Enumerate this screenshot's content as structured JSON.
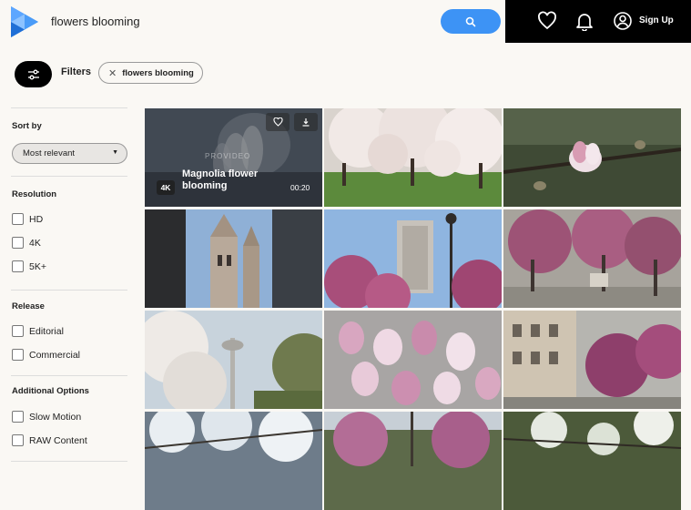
{
  "header": {
    "search_query": "flowers blooming",
    "signup_label": "Sign Up",
    "icons": [
      "logo-icon",
      "search-icon",
      "heart-icon",
      "bell-icon",
      "user-icon"
    ],
    "colors": {
      "search_button": "#3d93f5",
      "account_bar": "#000000",
      "logo": "#2f86f0"
    }
  },
  "filters": {
    "label": "Filters",
    "active_chip": "flowers blooming"
  },
  "sidebar": {
    "sort_title": "Sort by",
    "sort_value": "Most relevant",
    "resolution_title": "Resolution",
    "resolution_options": [
      "HD",
      "4K",
      "5K+"
    ],
    "release_title": "Release",
    "release_options": [
      "Editorial",
      "Commercial"
    ],
    "additional_title": "Additional Options",
    "additional_options": [
      "Slow Motion",
      "RAW Content"
    ]
  },
  "results": {
    "featured": {
      "badge": "4K",
      "title": "Magnolia flower blooming",
      "duration": "00:20",
      "watermark": "PROVIDEO"
    }
  }
}
